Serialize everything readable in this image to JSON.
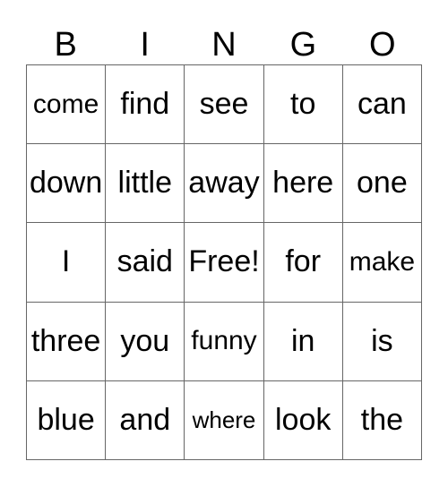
{
  "header": [
    "B",
    "I",
    "N",
    "G",
    "O"
  ],
  "rows": [
    [
      {
        "text": "come",
        "size": "sm"
      },
      {
        "text": "find"
      },
      {
        "text": "see"
      },
      {
        "text": "to"
      },
      {
        "text": "can"
      }
    ],
    [
      {
        "text": "down"
      },
      {
        "text": "little"
      },
      {
        "text": "away"
      },
      {
        "text": "here"
      },
      {
        "text": "one"
      }
    ],
    [
      {
        "text": "I"
      },
      {
        "text": "said"
      },
      {
        "text": "Free!"
      },
      {
        "text": "for"
      },
      {
        "text": "make",
        "size": "sm"
      }
    ],
    [
      {
        "text": "three"
      },
      {
        "text": "you"
      },
      {
        "text": "funny",
        "size": "sm"
      },
      {
        "text": "in"
      },
      {
        "text": "is"
      }
    ],
    [
      {
        "text": "blue"
      },
      {
        "text": "and"
      },
      {
        "text": "where",
        "size": "xs"
      },
      {
        "text": "look"
      },
      {
        "text": "the"
      }
    ]
  ]
}
